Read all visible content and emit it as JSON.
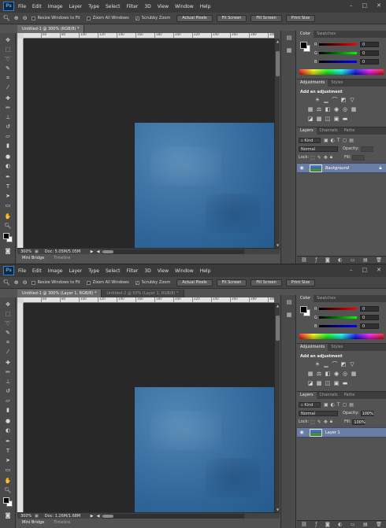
{
  "menu": {
    "logo": "Ps",
    "items": [
      "File",
      "Edit",
      "Image",
      "Layer",
      "Type",
      "Select",
      "Filter",
      "3D",
      "View",
      "Window",
      "Help"
    ],
    "window_controls": [
      "–",
      "□",
      "✕"
    ]
  },
  "options": {
    "resize_windows": "Resize Windows to Fit",
    "zoom_all": "Zoom All Windows",
    "scrubby_zoom": "Scrubby Zoom",
    "actual_pixels": "Actual Pixels",
    "fit_screen": "Fit Screen",
    "fill_screen": "Fill Screen",
    "print_size": "Print Size"
  },
  "rulers": {
    "top_ticks": [
      "60",
      "80",
      "100",
      "120",
      "140",
      "160",
      "180",
      "200",
      "220",
      "240",
      "260",
      "280",
      "300"
    ]
  },
  "colors": {
    "accent_layer": "#6a7ea3",
    "canvas_bg": "#282828",
    "image_blue": "#3f74a5"
  },
  "color_panel": {
    "tabs": [
      "Color",
      "Swatches"
    ],
    "r_label": "R",
    "g_label": "G",
    "b_label": "B",
    "r_value": "0",
    "g_value": "0",
    "b_value": "0"
  },
  "adjustments_panel": {
    "tabs": [
      "Adjustments",
      "Styles"
    ],
    "title": "Add an adjustment"
  },
  "layers_panel": {
    "tabs": [
      "Layers",
      "Channels",
      "Paths"
    ],
    "kind": "Kind",
    "blend_mode": "Normal",
    "opacity_label": "Opacity:",
    "lock_label": "Lock:",
    "fill_label": "Fill:"
  },
  "bottom_tabs": [
    "Mini Bridge",
    "Timeline"
  ],
  "instances": [
    {
      "doc_tabs": [
        {
          "label": "Untitled-1 @ 300% (RGB/8) *",
          "active": true
        }
      ],
      "zoom": "300%",
      "doc_size": "Doc: 5.05M/5.05M",
      "opacity": "",
      "fill": "",
      "layer_name": "Background",
      "layer_italic": true,
      "layer_locked": true
    },
    {
      "doc_tabs": [
        {
          "label": "Untitled-1 @ 300% (Layer 1, RGB/8) *",
          "active": true
        },
        {
          "label": "Untitled-2 @ 50% (Layer 1, RGB/8) *",
          "active": false
        }
      ],
      "zoom": "300%",
      "doc_size": "Doc: 1.26M/1.68M",
      "opacity": "100%",
      "fill": "100%",
      "layer_name": "Layer 1",
      "layer_italic": false,
      "layer_locked": false
    }
  ]
}
